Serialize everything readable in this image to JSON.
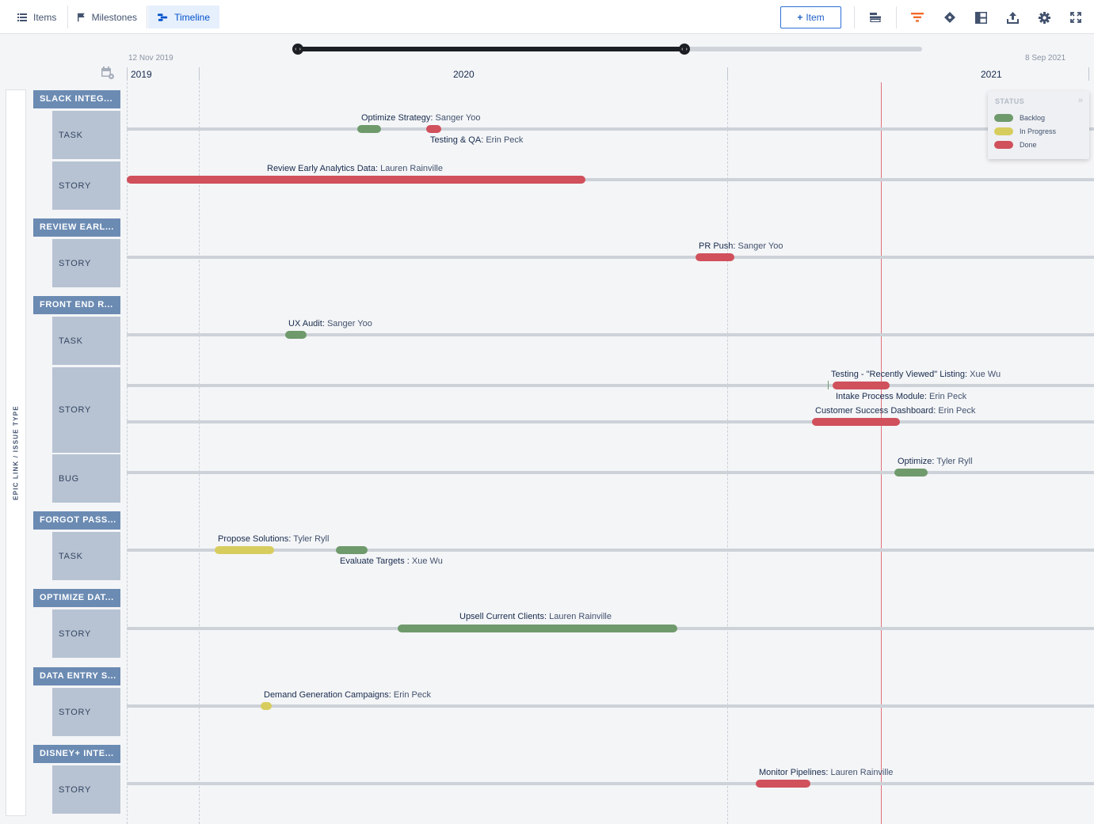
{
  "toolbar": {
    "tabs": [
      {
        "label": "Items",
        "icon": "list-icon"
      },
      {
        "label": "Milestones",
        "icon": "flag-icon"
      },
      {
        "label": "Timeline",
        "icon": "timeline-icon",
        "active": true
      }
    ],
    "add_button": {
      "icon": "+",
      "label": "Item"
    },
    "tools": [
      "row-layout-icon",
      "filter-icon",
      "milestone-diamond-icon",
      "panel-layout-icon",
      "export-icon",
      "settings-gear-icon",
      "fullscreen-icon"
    ]
  },
  "range": {
    "start": "12 Nov 2019",
    "end": "8 Sep 2021"
  },
  "axis": {
    "years": [
      "2019",
      "2020",
      "2021"
    ]
  },
  "grouping_label": "EPIC LINK / ISSUE TYPE",
  "legend": {
    "title": "STATUS",
    "collapse_icon": "»",
    "colors": {
      "Backlog": "#6f9a6c",
      "In Progress": "#d7cd5e",
      "Done": "#d0505c"
    },
    "items": [
      "Backlog",
      "In Progress",
      "Done"
    ]
  },
  "epics": [
    {
      "label": "SLACK INTEG...",
      "types": [
        "TASK",
        "STORY"
      ]
    },
    {
      "label": "REVIEW EARL...",
      "types": [
        "STORY"
      ]
    },
    {
      "label": "FRONT END R...",
      "types": [
        "TASK",
        "STORY",
        "BUG"
      ]
    },
    {
      "label": "FORGOT PASS...",
      "types": [
        "TASK"
      ]
    },
    {
      "label": "OPTIMIZE DAT...",
      "types": [
        "STORY"
      ]
    },
    {
      "label": "DATA ENTRY S...",
      "types": [
        "STORY"
      ]
    },
    {
      "label": "DISNEY+ INTE...",
      "types": [
        "STORY"
      ]
    }
  ],
  "items": [
    {
      "title": "Optimize Strategy",
      "owner": "Sanger Yoo",
      "status": "Backlog"
    },
    {
      "title": "Testing & QA",
      "owner": "Erin Peck",
      "status": "Done"
    },
    {
      "title": "Review Early Analytics Data",
      "owner": "Lauren Rainville",
      "status": "Done"
    },
    {
      "title": "PR Push",
      "owner": "Sanger Yoo",
      "status": "Done"
    },
    {
      "title": "UX Audit",
      "owner": "Sanger Yoo",
      "status": "Backlog"
    },
    {
      "title": "Testing - \"Recently Viewed\" Listing",
      "owner": "Xue Wu",
      "status": "Done"
    },
    {
      "title": "Intake Process Module",
      "owner": "Erin Peck",
      "status": "Done"
    },
    {
      "title": "Customer Success Dashboard",
      "owner": "Erin Peck",
      "status": "Done"
    },
    {
      "title": "Optimize",
      "owner": "Tyler Ryll",
      "status": "Backlog"
    },
    {
      "title": "Propose Solutions",
      "owner": "Tyler Ryll",
      "status": "In Progress"
    },
    {
      "title": "Evaluate Targets ",
      "owner": "Xue Wu",
      "status": "Backlog"
    },
    {
      "title": "Upsell Current Clients",
      "owner": "Lauren Rainville",
      "status": "Backlog"
    },
    {
      "title": "Demand Generation Campaigns",
      "owner": "Erin Peck",
      "status": "In Progress"
    },
    {
      "title": "Monitor Pipelines",
      "owner": "Lauren Rainville",
      "status": "Done"
    }
  ]
}
